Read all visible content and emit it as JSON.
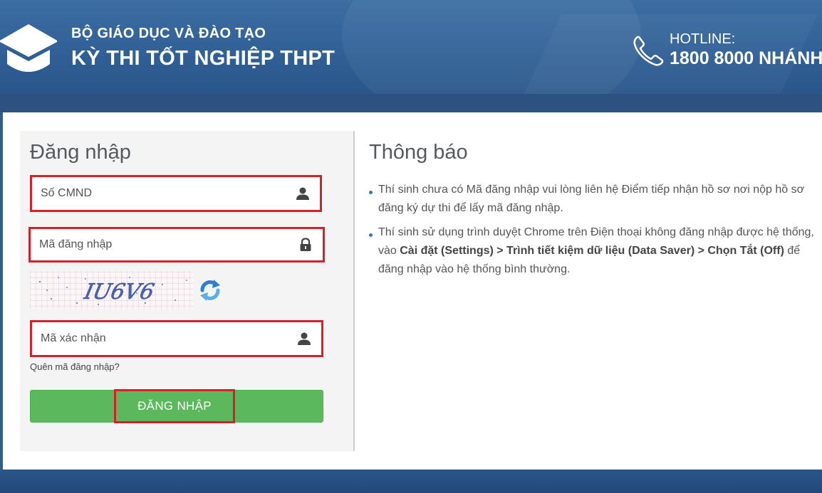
{
  "header": {
    "org_name": "BỘ GIÁO DỤC VÀ ĐÀO TẠO",
    "exam_name": "KỲ THI TỐT NGHIỆP THPT",
    "hotline_label": "HOTLINE:",
    "hotline_number": "1800 8000 NHÁNH"
  },
  "login": {
    "title": "Đăng nhập",
    "id_placeholder": "Số CMND",
    "code_placeholder": "Mã đăng nhập",
    "captcha_text": "IU6V6",
    "confirm_placeholder": "Mã xác nhận",
    "forgot_link": "Quên mã đăng nhập?",
    "submit_label": "ĐĂNG NHẬP"
  },
  "notice": {
    "title": "Thông báo",
    "item1": "Thí sinh chưa có Mã đăng nhập vui lòng liên hệ Điểm tiếp nhận hồ sơ nơi nộp hồ sơ đăng ký dự thi để lấy mã đăng nhập.",
    "item2_prefix": "Thí sinh sử dụng trình duyệt Chrome trên Điện thoại không đăng nhập được hệ thống, vào ",
    "item2_bold": "Cài đặt (Settings) > Trình tiết kiệm dữ liệu (Data Saver) > Chọn Tắt (Off)",
    "item2_suffix": " để đăng nhập vào hệ thống bình thường."
  },
  "colors": {
    "header_blue": "#2f5f95",
    "highlight_red": "#d4202a",
    "button_green": "#5cb85c"
  },
  "icons": {
    "logo": "graduation-cap-icon",
    "hotline": "phone-icon",
    "id_field": "user-icon",
    "code_field": "lock-icon",
    "confirm_field": "user-icon",
    "captcha_refresh": "refresh-icon"
  }
}
